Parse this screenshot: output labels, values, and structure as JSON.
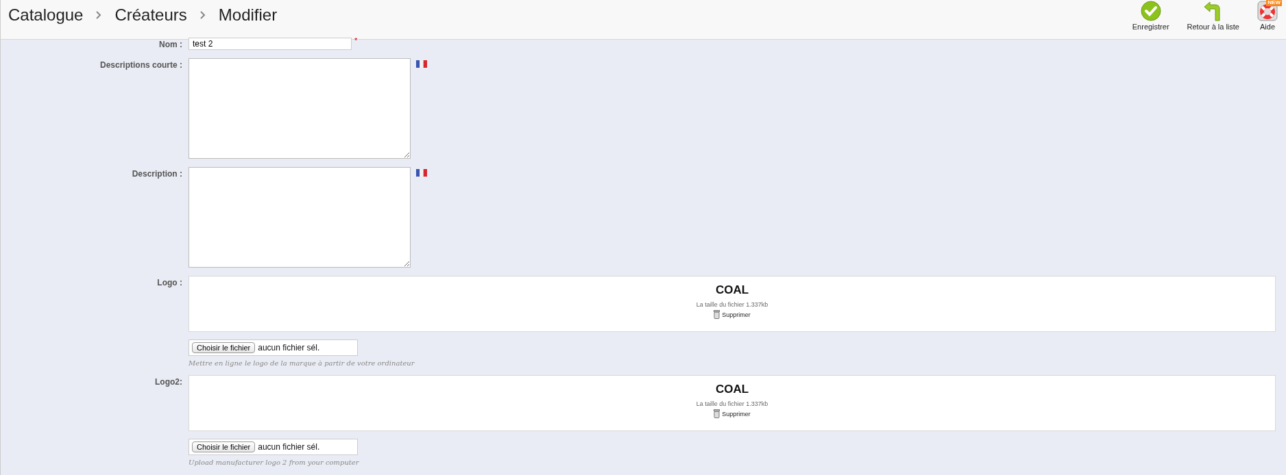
{
  "breadcrumb": [
    "Catalogue",
    "Créateurs",
    "Modifier"
  ],
  "toolbar": [
    {
      "kind": "save",
      "label": "Enregistrer"
    },
    {
      "kind": "back",
      "label": "Retour à la liste"
    },
    {
      "kind": "help",
      "label": "Aide",
      "badge": "NEW"
    }
  ],
  "fields": [
    {
      "kind": "text",
      "label": "Nom :",
      "value": "test 2",
      "required_mark": "*"
    },
    {
      "kind": "textarea",
      "label": "Descriptions courte :"
    },
    {
      "kind": "textarea",
      "label": "Description :"
    },
    {
      "kind": "image",
      "label": "Logo :",
      "logo_text": "COAL",
      "size_text": "La taille du fichier 1.337kb",
      "delete_label": "Supprimer",
      "file_button": "Choisir le fichier",
      "file_status": "aucun fichier sél.",
      "hint": "Mettre en ligne le logo de la marque à partir de votre ordinateur"
    },
    {
      "kind": "image",
      "label": "Logo2:",
      "logo_text": "COAL",
      "size_text": "La taille du fichier 1.337kb",
      "delete_label": "Supprimer",
      "file_button": "Choisir le fichier",
      "file_status": "aucun fichier sél.",
      "hint": "Upload manufacturer logo 2 from your computer"
    }
  ]
}
